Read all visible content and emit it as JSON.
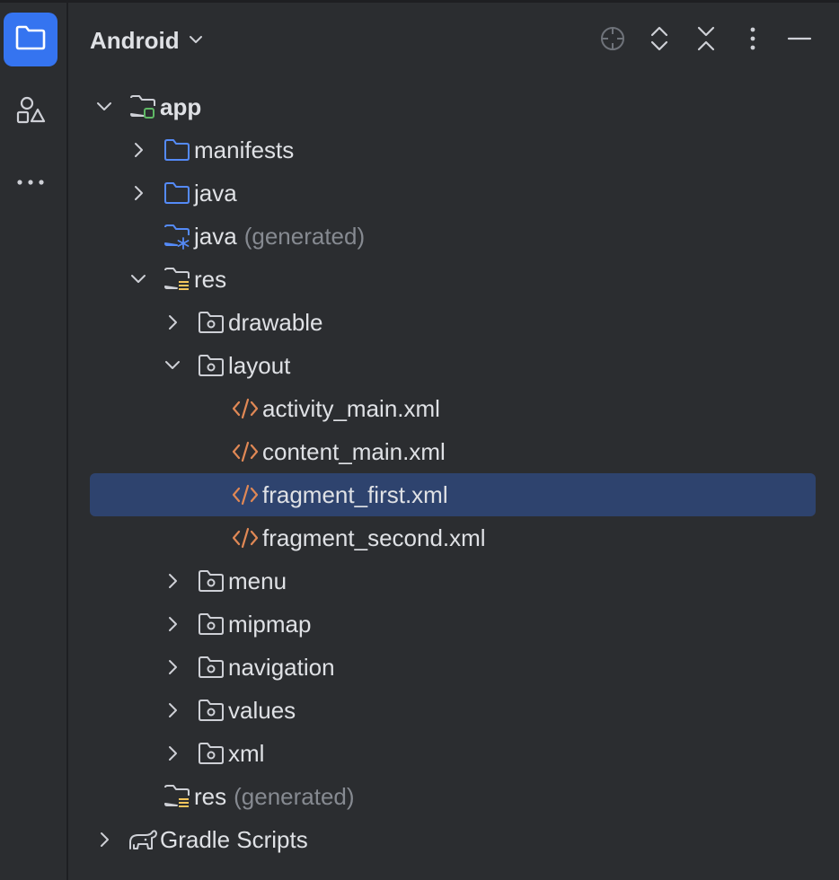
{
  "toolwindow": {
    "title": "Android",
    "header_buttons": [
      "locate-icon",
      "expand-all-icon",
      "collapse-all-icon",
      "more-options-icon",
      "hide-icon"
    ]
  },
  "sidebar": {
    "items": [
      {
        "name": "project",
        "icon": "folder-icon",
        "active": true
      },
      {
        "name": "resource-manager",
        "icon": "shapes-icon",
        "active": false
      },
      {
        "name": "more",
        "icon": "more-horizontal-icon",
        "active": false
      }
    ]
  },
  "tree": {
    "app": "app",
    "manifests": "manifests",
    "java": "java",
    "java_generated": "java",
    "java_generated_suffix": "(generated)",
    "res": "res",
    "drawable": "drawable",
    "layout": "layout",
    "activity_main": "activity_main.xml",
    "content_main": "content_main.xml",
    "fragment_first": "fragment_first.xml",
    "fragment_second": "fragment_second.xml",
    "menu": "menu",
    "mipmap": "mipmap",
    "navigation": "navigation",
    "values": "values",
    "xml": "xml",
    "res_generated": "res",
    "res_generated_suffix": "(generated)",
    "gradle_scripts": "Gradle Scripts"
  },
  "colors": {
    "background": "#2b2d30",
    "selection": "#2e436e",
    "accent": "#3574f0",
    "folder_blue": "#548af7",
    "xml_orange": "#e08855",
    "module_green": "#5fb865",
    "res_yellow": "#f2c55c"
  }
}
